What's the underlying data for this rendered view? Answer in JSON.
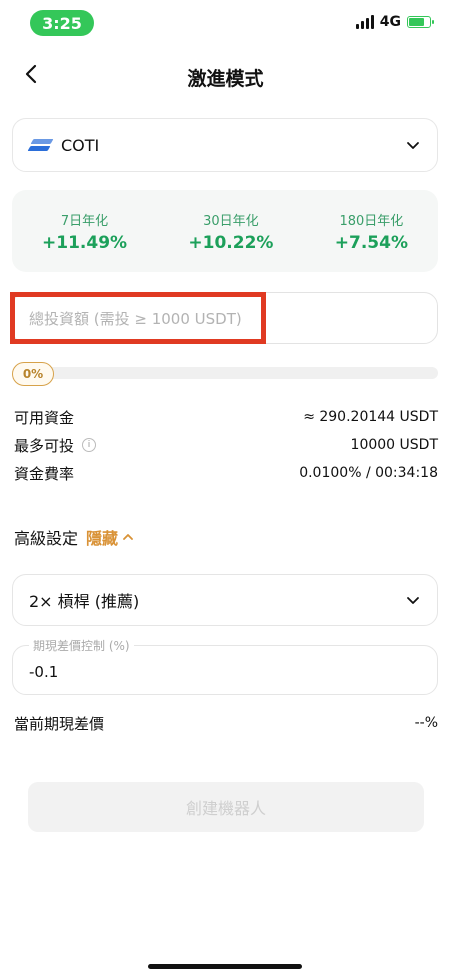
{
  "status": {
    "time": "3:25",
    "network": "4G"
  },
  "header": {
    "title": "激進模式"
  },
  "coin": {
    "name": "COTI"
  },
  "apy": [
    {
      "label": "7日年化",
      "value": "+11.49%"
    },
    {
      "label": "30日年化",
      "value": "+10.22%"
    },
    {
      "label": "180日年化",
      "value": "+7.54%"
    }
  ],
  "amount": {
    "placeholder": "總投資額 (需投 ≥ 1000 USDT)",
    "value": ""
  },
  "progress": {
    "label": "0%",
    "fraction": 0
  },
  "info": [
    {
      "label": "可用資金",
      "value": "≈ 290.20144 USDT"
    },
    {
      "label": "最多可投",
      "value": "10000 USDT"
    },
    {
      "label": "資金費率",
      "value": "0.0100% / 00:34:18"
    }
  ],
  "advanced": {
    "label": "高級設定",
    "toggle": "隱藏"
  },
  "leverage": {
    "value": "2× 槓桿 (推薦)"
  },
  "spread": {
    "label": "期現差價控制 (%)",
    "value": "-0.1"
  },
  "current_spread": {
    "label": "當前期現差價",
    "value": "--%"
  },
  "submit": {
    "label": "創建機器人"
  },
  "colors": {
    "accent_green": "#1ca05a",
    "accent_orange": "#d99236",
    "highlight_red": "#e03a22"
  }
}
